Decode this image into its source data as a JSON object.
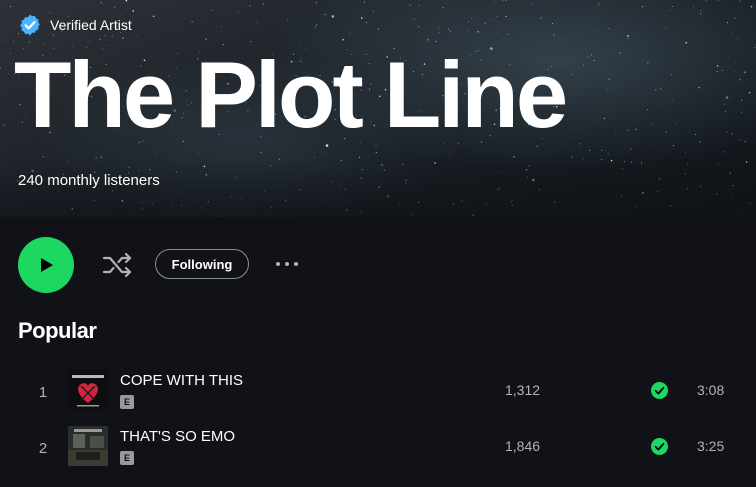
{
  "header": {
    "verified_label": "Verified Artist",
    "artist_name": "The Plot Line",
    "monthly_listeners": "240 monthly listeners"
  },
  "controls": {
    "following_label": "Following"
  },
  "popular": {
    "title": "Popular",
    "tracks": [
      {
        "index": "1",
        "title": "COPE WITH THIS",
        "explicit": "E",
        "plays": "1,312",
        "duration": "3:08",
        "saved": true
      },
      {
        "index": "2",
        "title": "THAT'S SO EMO",
        "explicit": "E",
        "plays": "1,846",
        "duration": "3:25",
        "saved": true
      }
    ]
  },
  "colors": {
    "accent_green": "#1ed760",
    "verified_blue": "#4cb3ff",
    "background": "#101217"
  },
  "icons": {
    "verified": "verified-badge-icon",
    "play": "play-icon",
    "shuffle": "shuffle-icon",
    "more": "more-options-icon",
    "saved": "check-circle-icon"
  }
}
